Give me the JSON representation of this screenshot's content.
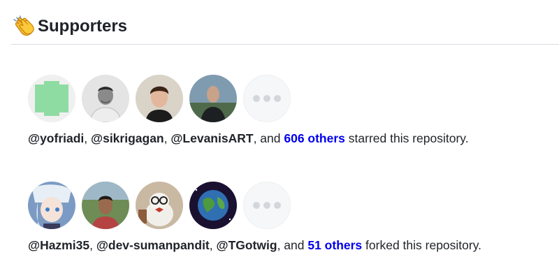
{
  "header": {
    "icon": "clapping-hands-icon",
    "title": "Supporters"
  },
  "stargazers": {
    "avatars": [
      "identicon-avatar",
      "user-avatar",
      "user-avatar",
      "user-avatar"
    ],
    "users": [
      "@yofriadi",
      "@sikrigagan",
      "@LevanisART"
    ],
    "sep": ", ",
    "and": ", and ",
    "others": "606 others",
    "suffix": " starred this repository."
  },
  "forkers": {
    "users": [
      "@Hazmi35",
      "@dev-sumanpandit",
      "@TGotwig"
    ],
    "sep": ", ",
    "and": ", and ",
    "others": "51 others",
    "suffix": " forked this repository."
  },
  "colors": {
    "link": "#0000ee",
    "text": "#1f2328",
    "divider": "#d8dee4"
  }
}
